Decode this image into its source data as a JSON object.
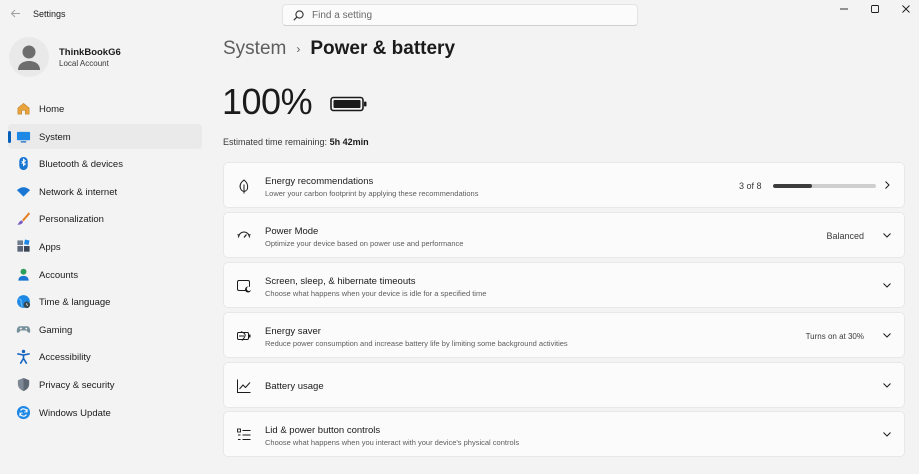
{
  "window": {
    "title": "Settings",
    "minimize_icon": "minimize-icon",
    "maximize_icon": "maximize-icon",
    "close_icon": "close-icon"
  },
  "search": {
    "placeholder": "Find a setting",
    "value": ""
  },
  "profile": {
    "name": "ThinkBookG6",
    "account_type": "Local Account"
  },
  "sidebar": {
    "items": [
      {
        "label": "Home",
        "icon": "home-icon",
        "active": false
      },
      {
        "label": "System",
        "icon": "system-icon",
        "active": true
      },
      {
        "label": "Bluetooth & devices",
        "icon": "bluetooth-icon",
        "active": false
      },
      {
        "label": "Network & internet",
        "icon": "wifi-icon",
        "active": false
      },
      {
        "label": "Personalization",
        "icon": "brush-icon",
        "active": false
      },
      {
        "label": "Apps",
        "icon": "apps-icon",
        "active": false
      },
      {
        "label": "Accounts",
        "icon": "person-icon",
        "active": false
      },
      {
        "label": "Time & language",
        "icon": "globe-clock-icon",
        "active": false
      },
      {
        "label": "Gaming",
        "icon": "gamepad-icon",
        "active": false
      },
      {
        "label": "Accessibility",
        "icon": "accessibility-icon",
        "active": false
      },
      {
        "label": "Privacy & security",
        "icon": "shield-icon",
        "active": false
      },
      {
        "label": "Windows Update",
        "icon": "update-icon",
        "active": false
      }
    ]
  },
  "breadcrumb": {
    "parent": "System",
    "separator": "›",
    "current": "Power & battery"
  },
  "battery": {
    "percent": "100%",
    "level": 1.0,
    "estimate_label": "Estimated time remaining:",
    "estimate_value": "5h 42min"
  },
  "cards": [
    {
      "title": "Energy recommendations",
      "description": "Lower your carbon footprint by applying these recommendations",
      "value": "3 of 8",
      "progress": 0.375,
      "icon": "leaf-icon",
      "chevron": "chevron-right-icon"
    },
    {
      "title": "Power Mode",
      "description": "Optimize your device based on power use and performance",
      "value": "Balanced",
      "icon": "power-mode-icon",
      "chevron": "chevron-down-icon"
    },
    {
      "title": "Screen, sleep, & hibernate timeouts",
      "description": "Choose what happens when your device is idle for a specified time",
      "value": "",
      "icon": "screen-sleep-icon",
      "chevron": "chevron-down-icon"
    },
    {
      "title": "Energy saver",
      "description": "Reduce power consumption and increase battery life by limiting some background activities",
      "value": "Turns on at 30%",
      "icon": "battery-saver-icon",
      "chevron": "chevron-down-icon"
    },
    {
      "title": "Battery usage",
      "description": "",
      "value": "",
      "icon": "chart-line-icon",
      "chevron": "chevron-down-icon"
    },
    {
      "title": "Lid & power button controls",
      "description": "Choose what happens when you interact with your device's physical controls",
      "value": "",
      "icon": "list-controls-icon",
      "chevron": "chevron-down-icon"
    }
  ],
  "colors": {
    "accent": "#005fb8",
    "background": "#f3f3f3",
    "card": "#fbfbfb"
  }
}
